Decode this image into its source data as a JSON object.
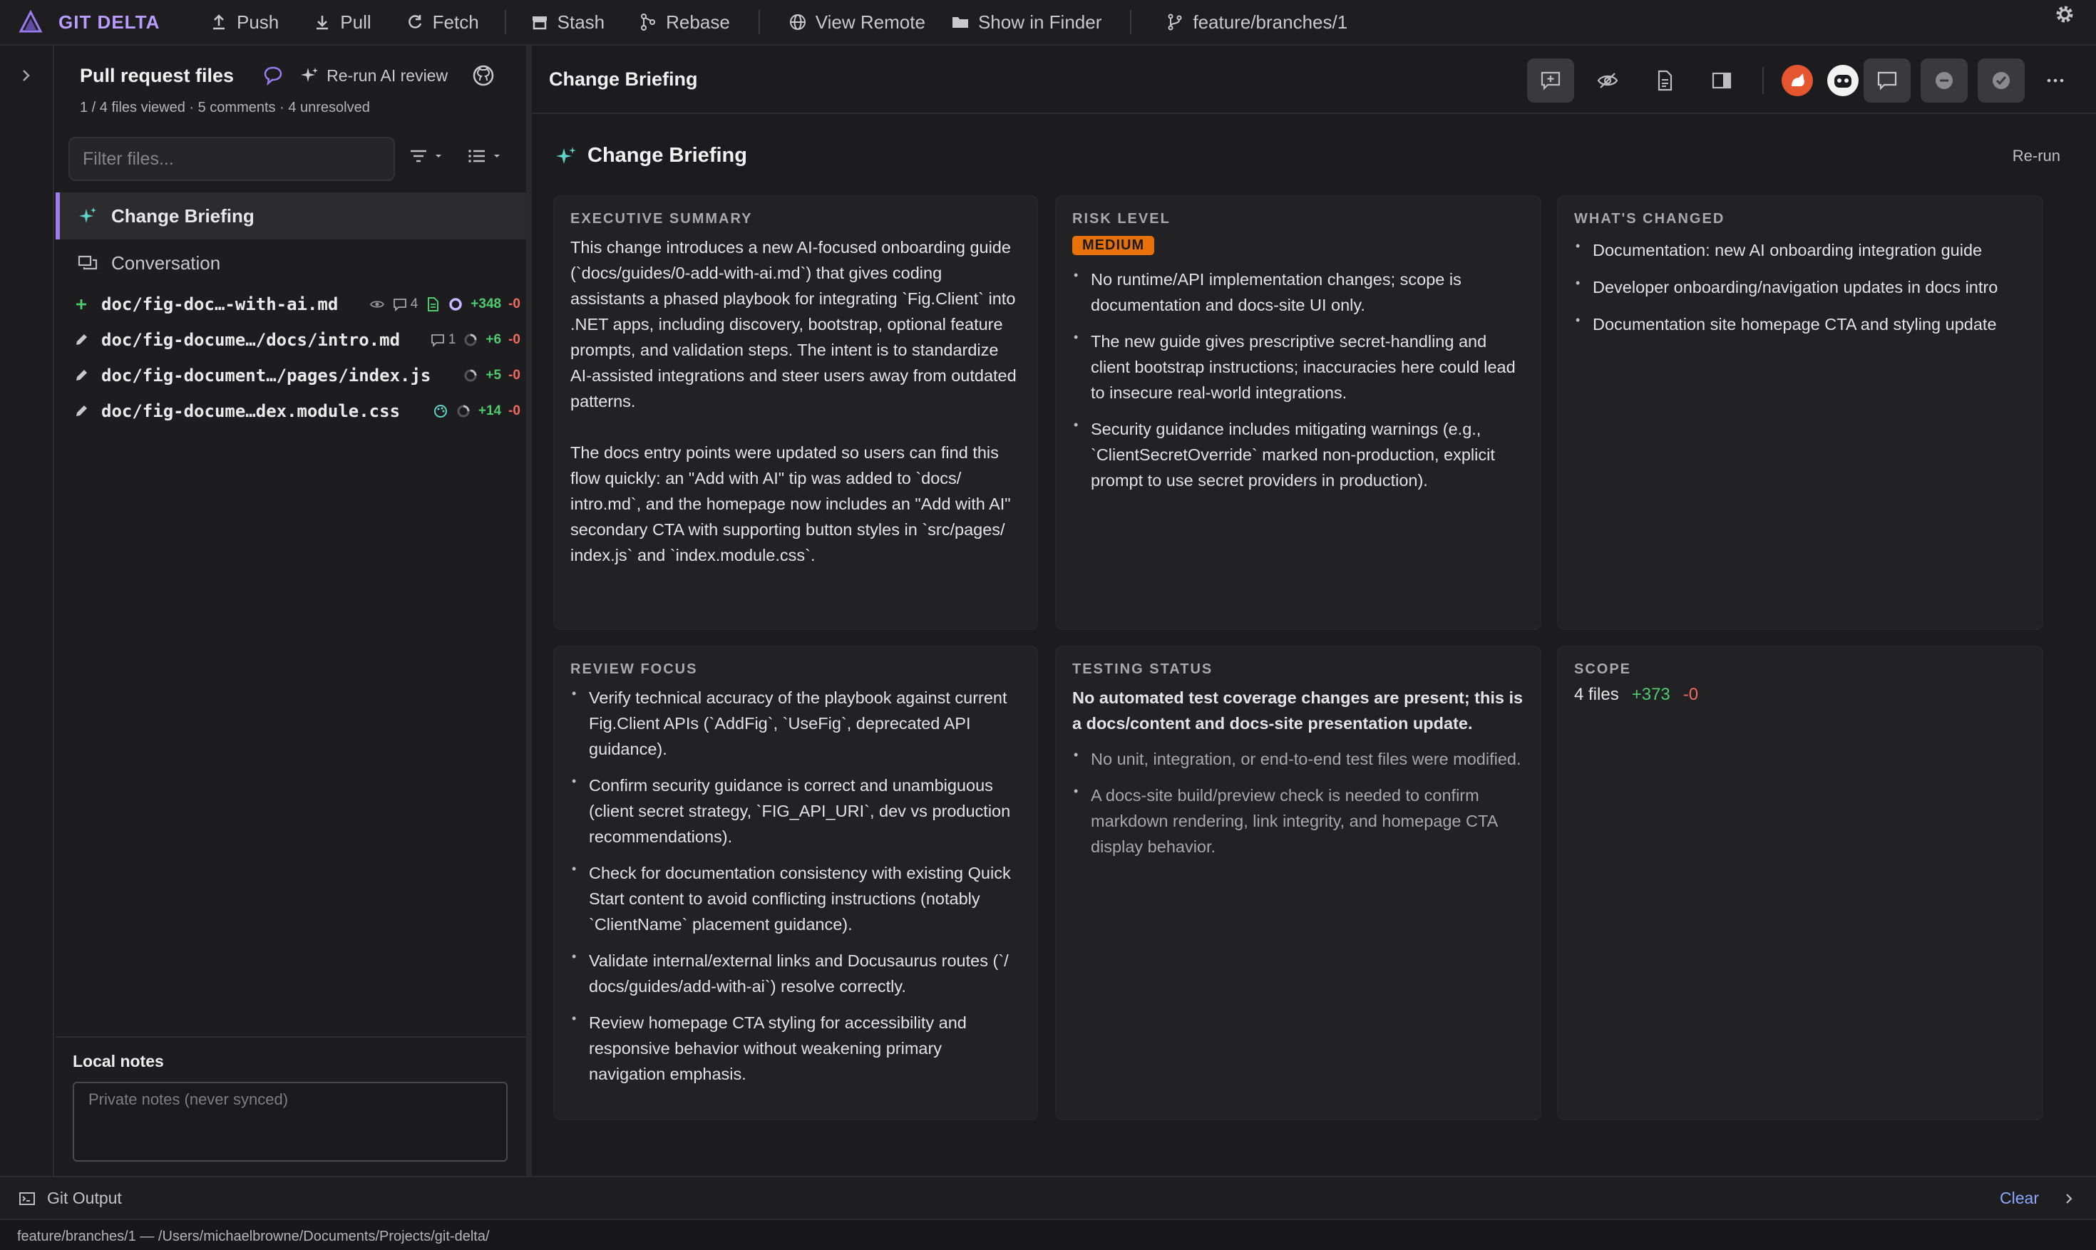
{
  "app": {
    "brand": "GIT DELTA"
  },
  "toolbar": {
    "push": "Push",
    "pull": "Pull",
    "fetch": "Fetch",
    "stash": "Stash",
    "rebase": "Rebase",
    "view_remote": "View Remote",
    "show_in_finder": "Show in Finder",
    "branch": "feature/branches/1"
  },
  "sidebar": {
    "title": "Pull request files",
    "rerun_ai_review": "Re-run AI review",
    "subtitle": "1 / 4 files viewed · 5 comments · 4 unresolved",
    "filter_placeholder": "Filter files...",
    "nav": {
      "briefing": "Change Briefing",
      "conversation": "Conversation"
    },
    "files": [
      {
        "name": "doc/fig-doc…-with-ai.md",
        "status": "added",
        "comments": "4",
        "add": "+348",
        "del": "-0"
      },
      {
        "name": "doc/fig-docume…/docs/intro.md",
        "status": "modified",
        "comments": "1",
        "add": "+6",
        "del": "-0"
      },
      {
        "name": "doc/fig-document…/pages/index.js",
        "status": "modified",
        "comments": "",
        "add": "+5",
        "del": "-0"
      },
      {
        "name": "doc/fig-docume…dex.module.css",
        "status": "modified",
        "comments": "",
        "add": "+14",
        "del": "-0"
      }
    ],
    "notes_label": "Local notes",
    "notes_placeholder": "Private notes (never synced)"
  },
  "main": {
    "header_title": "Change Briefing",
    "briefing_title": "Change Briefing",
    "rerun": "Re-run",
    "executive_summary": {
      "heading": "EXECUTIVE SUMMARY",
      "p1": "This change introduces a new AI-focused onboarding guide (`docs/guides/0-add-with-ai.md`) that gives coding assistants a phased playbook for integrating `Fig.Client` into .NET apps, including discovery, bootstrap, optional feature prompts, and validation steps. The intent is to standardize AI-assisted integrations and steer users away from outdated patterns.",
      "p2": "The docs entry points were updated so users can find this flow quickly: an \"Add with AI\" tip was added to `docs/ intro.md`, and the homepage now includes an \"Add with AI\" secondary CTA with supporting button styles in `src/pages/ index.js` and `index.module.css`."
    },
    "risk_level": {
      "heading": "RISK LEVEL",
      "badge": "MEDIUM",
      "items": [
        "No runtime/API implementation changes; scope is documentation and docs-site UI only.",
        "The new guide gives prescriptive secret-handling and client bootstrap instructions; inaccuracies here could lead to insecure real-world integrations.",
        "Security guidance includes mitigating warnings (e.g., `ClientSecretOverride` marked non-production, explicit prompt to use secret providers in production)."
      ]
    },
    "whats_changed": {
      "heading": "WHAT'S CHANGED",
      "items": [
        "Documentation: new AI onboarding integration guide",
        "Developer onboarding/navigation updates in docs intro",
        "Documentation site homepage CTA and styling update"
      ]
    },
    "review_focus": {
      "heading": "REVIEW FOCUS",
      "items": [
        "Verify technical accuracy of the playbook against current Fig.Client APIs (`AddFig`, `UseFig`, deprecated API guidance).",
        "Confirm security guidance is correct and unambiguous (client secret strategy, `FIG_API_URI`, dev vs production recommendations).",
        "Check for documentation consistency with existing Quick Start content to avoid conflicting instructions (notably `ClientName` placement guidance).",
        "Validate internal/external links and Docusaurus routes (`/ docs/guides/add-with-ai`) resolve correctly.",
        "Review homepage CTA styling for accessibility and responsive behavior without weakening primary navigation emphasis."
      ]
    },
    "testing_status": {
      "heading": "TESTING STATUS",
      "summary": "No automated test coverage changes are present; this is a docs/content and docs-site presentation update.",
      "items": [
        "No unit, integration, or end-to-end test files were modified.",
        "A docs-site build/preview check is needed to confirm markdown rendering, link integrity, and homepage CTA display behavior."
      ]
    },
    "scope": {
      "heading": "SCOPE",
      "files": "4 files",
      "add": "+373",
      "del": "-0"
    }
  },
  "output": {
    "label": "Git Output",
    "clear": "Clear"
  },
  "status_bar": {
    "path": "feature/branches/1 — /Users/michaelbrowne/Documents/Projects/git-delta/"
  },
  "colors": {
    "accent": "#9a7cf0",
    "add": "#4ecb71",
    "del": "#f06a5e",
    "badge": "#e8710a",
    "link": "#8ea6ff"
  },
  "icons": [
    "logo-icon",
    "push-icon",
    "pull-icon",
    "fetch-icon",
    "stash-icon",
    "rebase-icon",
    "globe-icon",
    "folder-icon",
    "branch-icon",
    "gear-icon",
    "chevron-right-icon",
    "comment-icon",
    "sparkle-icon",
    "github-icon",
    "filter-icon",
    "list-icon",
    "eye-icon",
    "file-icon",
    "circle-icon",
    "palette-icon",
    "terminal-icon"
  ]
}
